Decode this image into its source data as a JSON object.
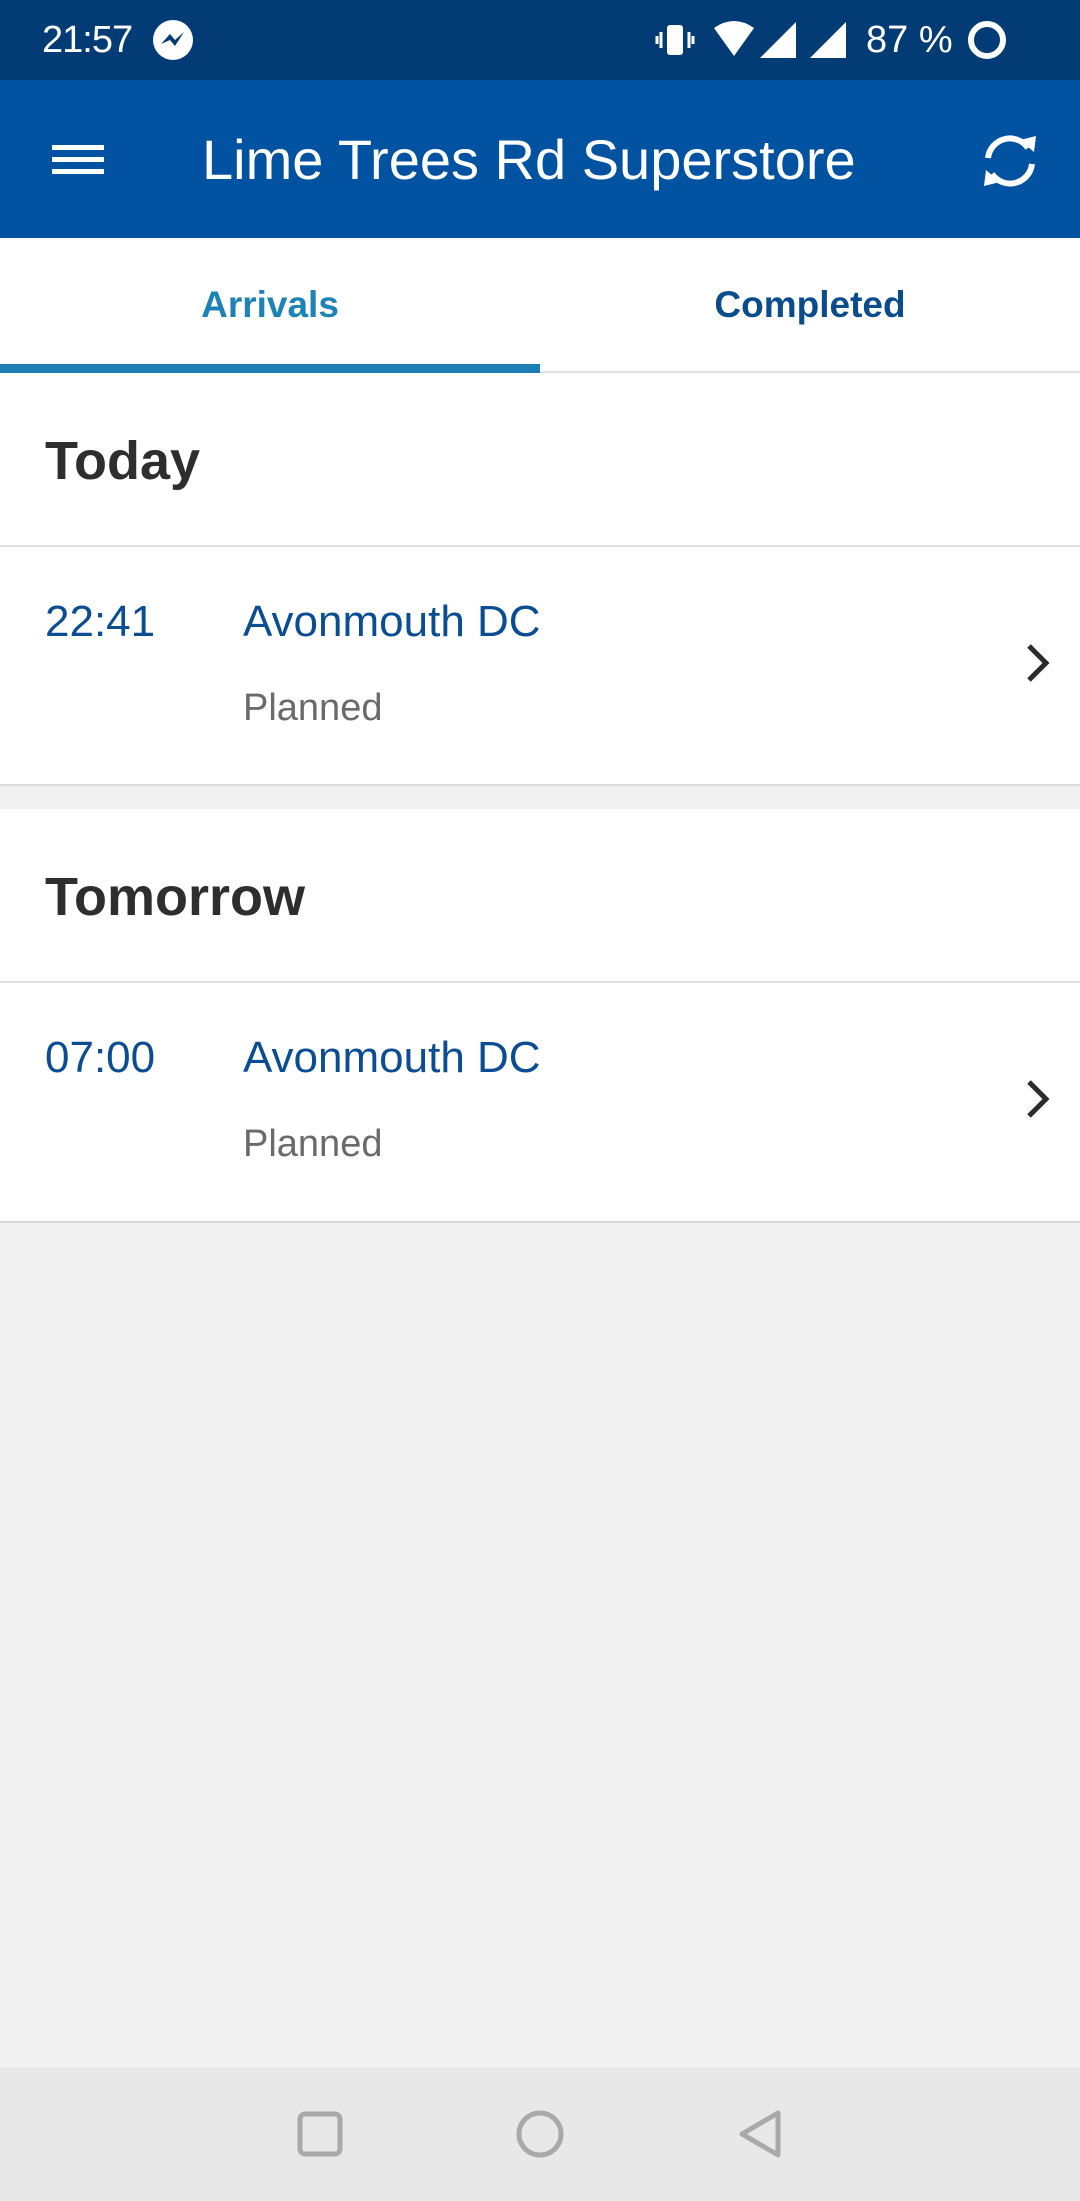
{
  "status_bar": {
    "time": "21:57",
    "battery_percent": "87 %",
    "icons": [
      "messenger-icon",
      "vibrate-icon",
      "wifi-icon",
      "signal-icon",
      "signal-icon",
      "battery-ring-icon"
    ]
  },
  "app_bar": {
    "title": "Lime Trees Rd Superstore",
    "menu_icon": "hamburger-menu-icon",
    "refresh_icon": "refresh-icon"
  },
  "tabs": [
    {
      "label": "Arrivals",
      "selected": true
    },
    {
      "label": "Completed",
      "selected": false
    }
  ],
  "sections": [
    {
      "heading": "Today",
      "deliveries": [
        {
          "time": "22:41",
          "origin": "Avonmouth DC",
          "status": "Planned"
        }
      ]
    },
    {
      "heading": "Tomorrow",
      "deliveries": [
        {
          "time": "07:00",
          "origin": "Avonmouth DC",
          "status": "Planned"
        }
      ]
    }
  ],
  "nav_bar": {
    "icons": [
      "recents-square-icon",
      "home-circle-icon",
      "back-triangle-icon"
    ]
  },
  "colors": {
    "status_bar": "#033c74",
    "app_bar": "#0152a1",
    "tab_active": "#1d82b6",
    "tab_inactive": "#0a4c8c",
    "link_text": "#0b4d93",
    "background": "#f1f1f1"
  }
}
